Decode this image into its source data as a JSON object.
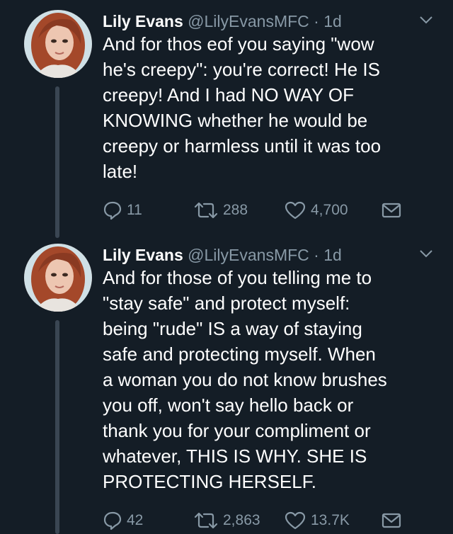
{
  "tweets": [
    {
      "name": "Lily Evans",
      "handle": "@LilyEvansMFC",
      "dot": "·",
      "time": "1d",
      "text": "And for thos eof you saying \"wow\nhe's creepy\": you're correct! He IS\ncreepy! And I had NO WAY OF\nKNOWING whether he would be\ncreepy or harmless until it was too\nlate!",
      "replies": "11",
      "retweets": "288",
      "likes": "4,700"
    },
    {
      "name": "Lily Evans",
      "handle": "@LilyEvansMFC",
      "dot": "·",
      "time": "1d",
      "text": "And for those of you telling me to\n\"stay safe\" and protect myself:\nbeing \"rude\" IS a way of staying\nsafe and protecting myself. When\na woman you do not know brushes\nyou off, won't say hello back or\nthank you for your compliment or\nwhatever, THIS IS WHY. SHE IS\nPROTECTING HERSELF.",
      "replies": "42",
      "retweets": "2,863",
      "likes": "13.7K"
    }
  ],
  "icons": {
    "reply": "reply-icon",
    "retweet": "retweet-icon",
    "like": "heart-icon",
    "message": "envelope-icon",
    "more": "chevron-down-icon"
  },
  "colors": {
    "background": "#141d26",
    "secondary_text": "#8899a6",
    "thread_line": "#3a4653"
  }
}
